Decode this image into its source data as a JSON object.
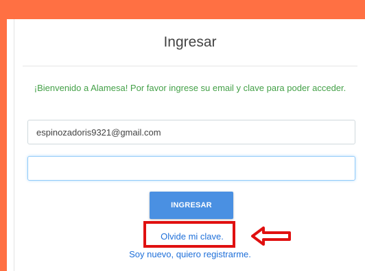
{
  "login": {
    "title": "Ingresar",
    "welcome_text": "¡Bienvenido a Alamesa! Por favor ingrese su email y clave para poder acceder.",
    "email_value": "espinozadoris9321@gmail.com",
    "password_value": "",
    "submit_label": "INGRESAR",
    "forgot_label": "Olvide mi clave.",
    "register_label": "Soy nuevo, quiero registrarme."
  },
  "colors": {
    "accent": "#ff7043",
    "button": "#4a90e2",
    "link": "#1e6fd9",
    "welcome": "#43a047",
    "annotation": "#e01010"
  },
  "annotation": {
    "arrow_icon": "left-arrow-icon"
  }
}
